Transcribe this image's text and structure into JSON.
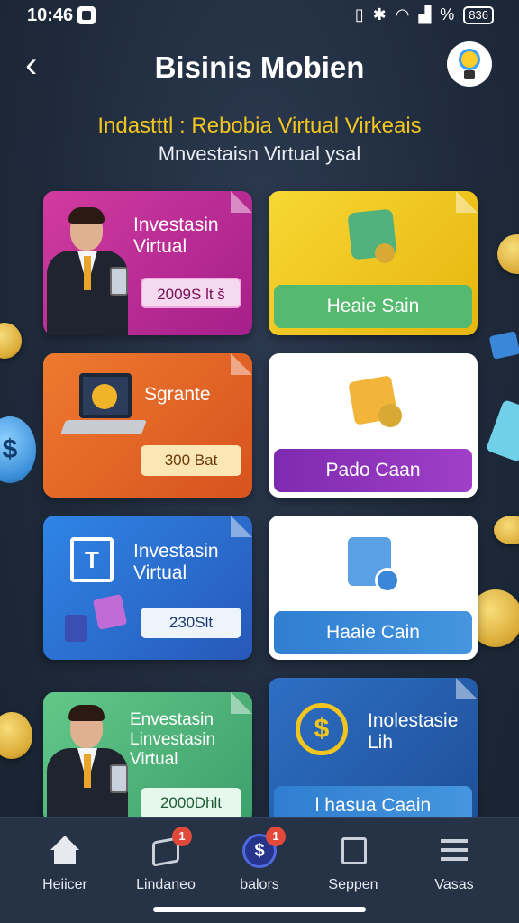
{
  "status_bar": {
    "time": "10:46",
    "battery": "836"
  },
  "header": {
    "title": "Bisinis Mobien"
  },
  "headline": "Indastttl : Rebobia Virtual Virkeais",
  "subheadline": "Mnvestaisn Virtual ysal",
  "cards": [
    {
      "title_line1": "Investasin",
      "title_line2": "Virtual",
      "value": "2009S lt š"
    },
    {
      "action": "Heaie Sain"
    },
    {
      "title_line1": "Sgrante",
      "value": "300 Bat"
    },
    {
      "action": "Pado Caan"
    },
    {
      "title_line1": "Investasin",
      "title_line2": "Virtual",
      "value": "230Slt"
    },
    {
      "action": "Haaie Cain"
    },
    {
      "title_line1": "Envestasin",
      "title_line2": "Linvestasin",
      "title_line3": "Virtual",
      "value": "2000Dhlt"
    },
    {
      "title_line1": "Inolestasie",
      "title_line2": "Lih",
      "action": "l hasua Caain"
    }
  ],
  "bottom_nav": [
    {
      "label": "Heiicer",
      "icon": "home-icon"
    },
    {
      "label": "Lindaneo",
      "icon": "box-icon",
      "badge": "1"
    },
    {
      "label": "balors",
      "icon": "dollar-coin-icon",
      "badge": "1"
    },
    {
      "label": "Seppen",
      "icon": "cube-icon"
    },
    {
      "label": "Vasas",
      "icon": "menu-icon"
    }
  ],
  "colors": {
    "accent_yellow": "#f2c61f",
    "magenta_card": "#c2268f",
    "orange_card": "#e2662a",
    "blue_card": "#2f73d6",
    "green_card": "#4fbf7e"
  }
}
